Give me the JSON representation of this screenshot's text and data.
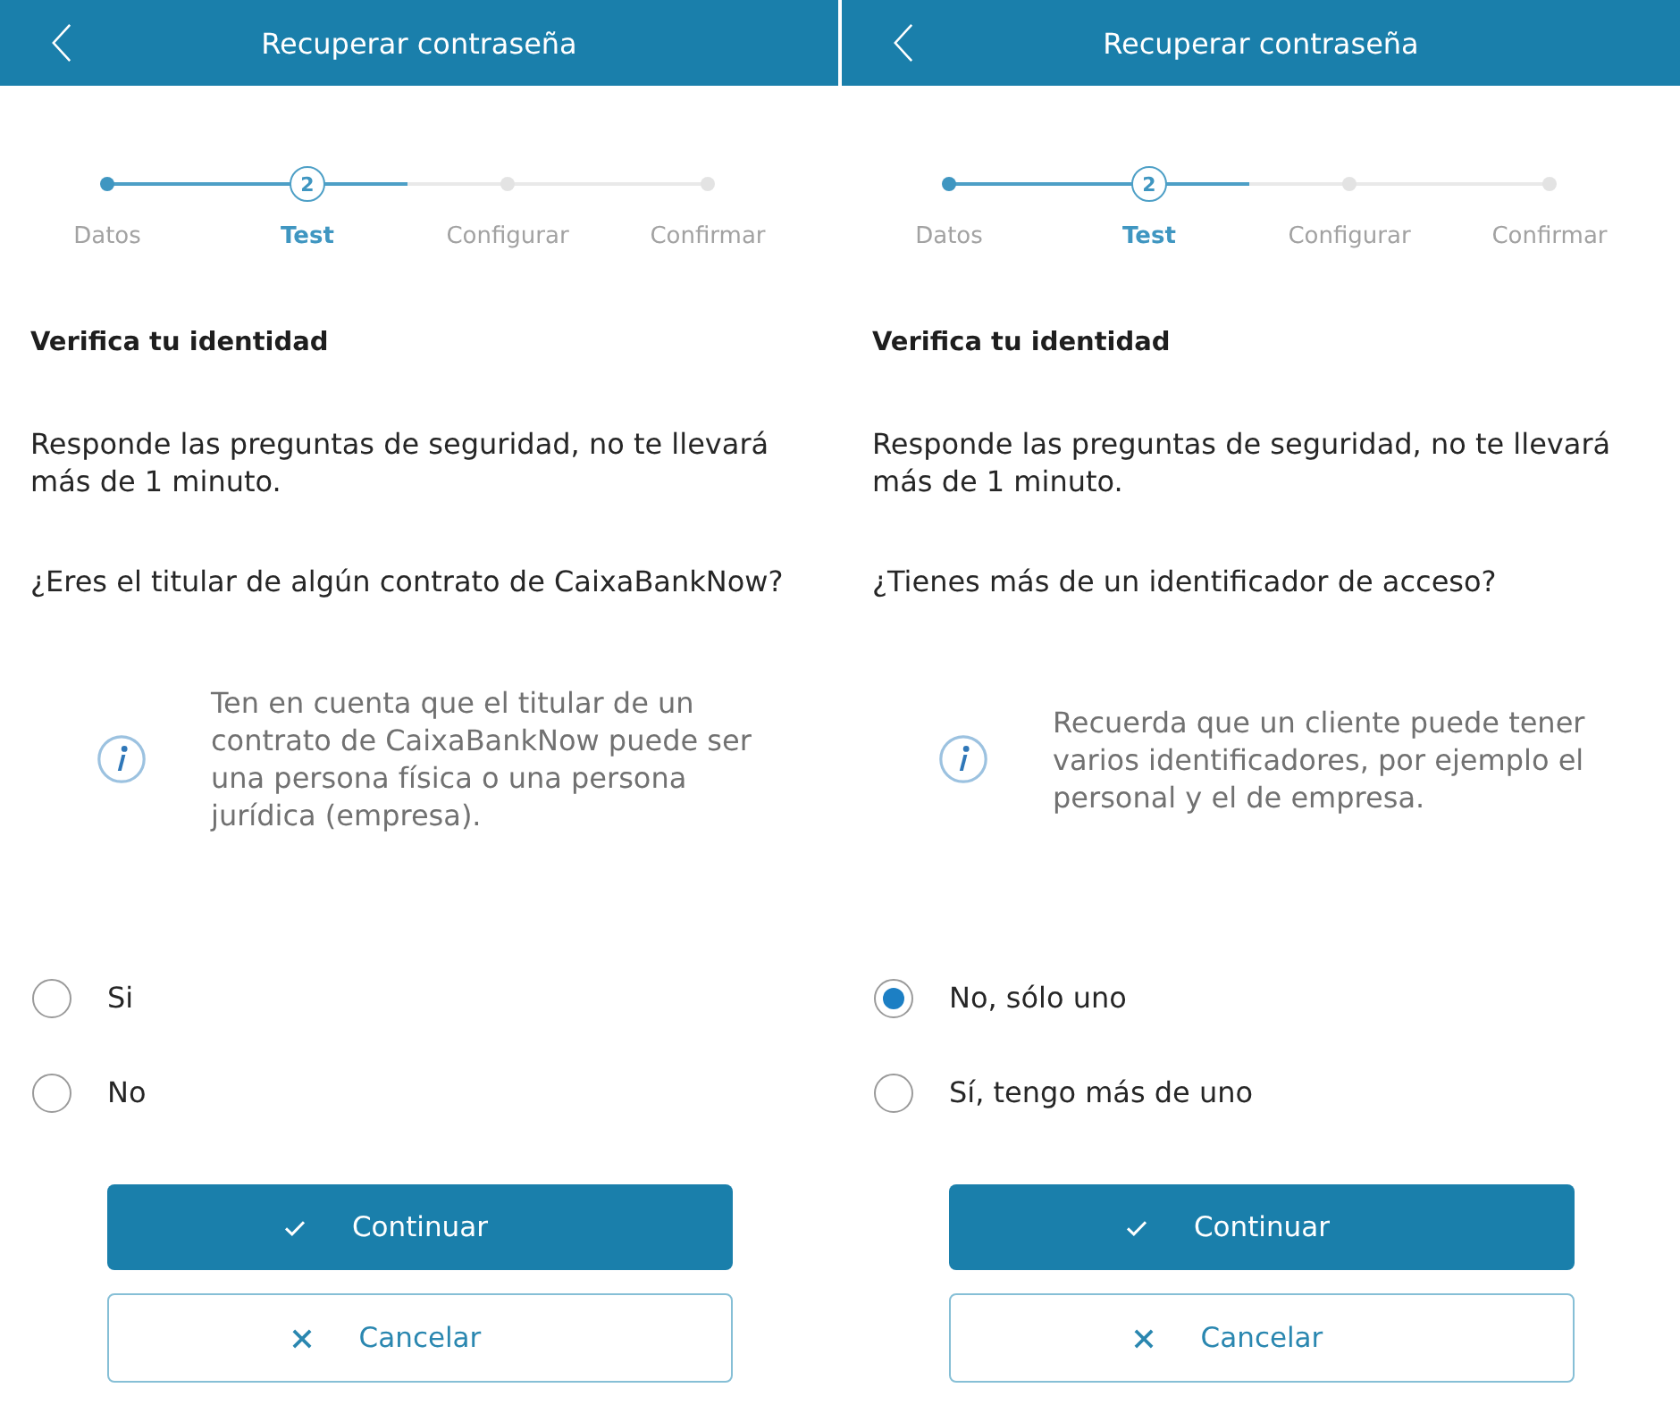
{
  "screens": [
    {
      "header": {
        "title": "Recuperar contraseña"
      },
      "steps": [
        {
          "label": "Datos",
          "completed": true,
          "current": false
        },
        {
          "label": "Test",
          "completed": false,
          "current": true,
          "number": "2"
        },
        {
          "label": "Configurar",
          "completed": false,
          "current": false
        },
        {
          "label": "Confirmar",
          "completed": false,
          "current": false
        }
      ],
      "heading": "Verifica tu identidad",
      "intro": "Responde las preguntas de seguridad, no te llevará más de 1 minuto.",
      "question": "¿Eres el titular de algún contrato de CaixaBankNow?",
      "info": "Ten en cuenta que el titular de un contrato de CaixaBankNow puede ser una persona física o una persona jurídica (empresa).",
      "options": [
        {
          "label": "Si",
          "selected": false
        },
        {
          "label": "No",
          "selected": false
        }
      ],
      "buttons": [
        {
          "kind": "primary",
          "label": "Continuar"
        },
        {
          "kind": "secondary",
          "label": "Cancelar"
        }
      ]
    },
    {
      "header": {
        "title": "Recuperar contraseña"
      },
      "steps": [
        {
          "label": "Datos",
          "completed": true,
          "current": false
        },
        {
          "label": "Test",
          "completed": false,
          "current": true,
          "number": "2"
        },
        {
          "label": "Configurar",
          "completed": false,
          "current": false
        },
        {
          "label": "Confirmar",
          "completed": false,
          "current": false
        }
      ],
      "heading": "Verifica tu identidad",
      "intro": "Responde las preguntas de seguridad, no te llevará más de 1 minuto.",
      "question": "¿Tienes más de un identificador de acceso?",
      "info": "Recuerda que un cliente puede tener varios identificadores, por ejemplo el personal y el de empresa.",
      "options": [
        {
          "label": "No, sólo uno",
          "selected": true
        },
        {
          "label": "Sí, tengo más de uno",
          "selected": false
        }
      ],
      "buttons": [
        {
          "kind": "primary",
          "label": "Continuar"
        },
        {
          "kind": "secondary",
          "label": "Cancelar"
        }
      ]
    }
  ]
}
